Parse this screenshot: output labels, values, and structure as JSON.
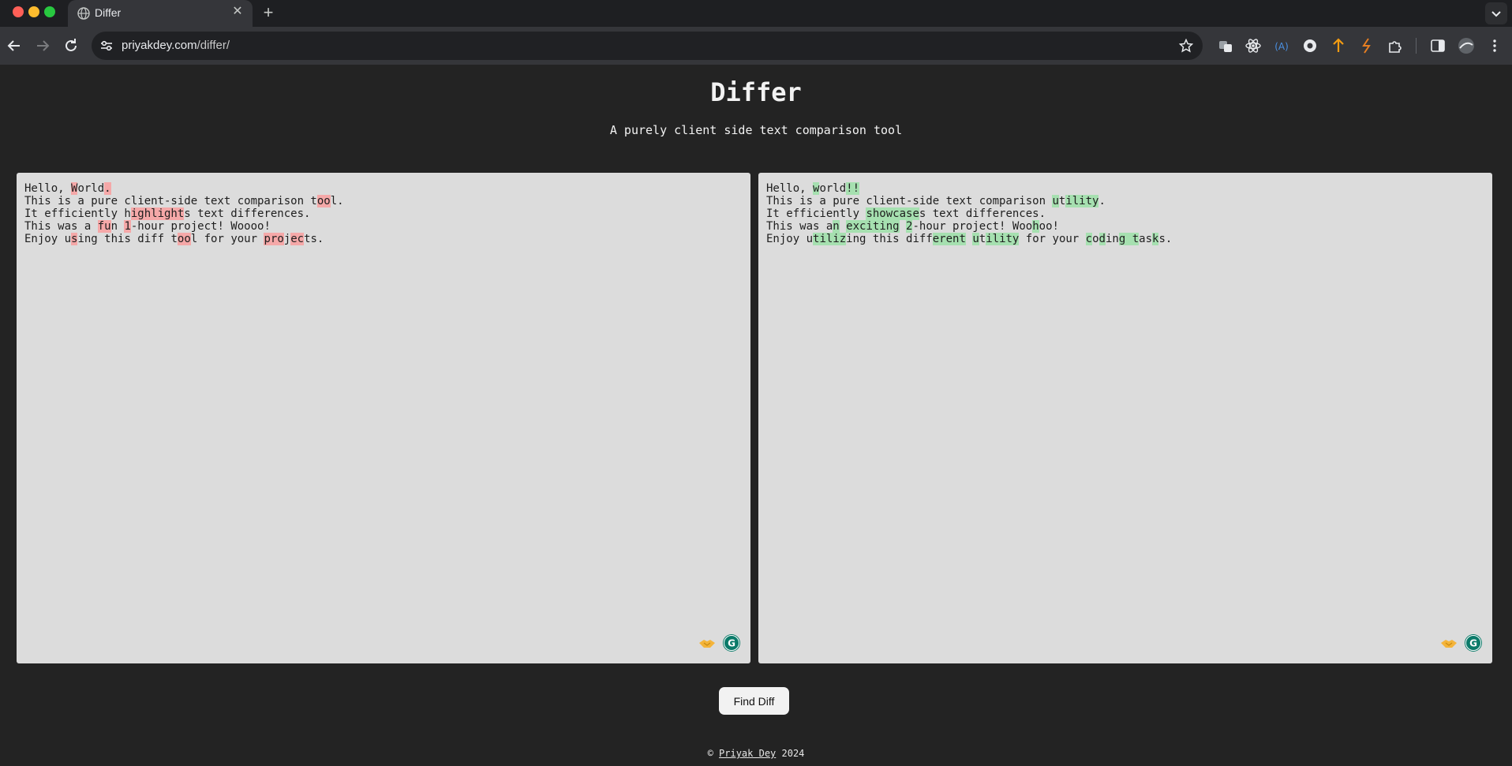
{
  "browser": {
    "tab": {
      "title": "Differ",
      "close": "✕"
    },
    "new_tab": "+",
    "omnibox": {
      "url_host": "priyakdey.com",
      "url_path": "/differ/"
    }
  },
  "page": {
    "title": "Differ",
    "subtitle": "A purely client side text comparison tool"
  },
  "left_pane": {
    "lines": [
      [
        {
          "t": "Hello, "
        },
        {
          "t": "W",
          "d": 1
        },
        {
          "t": "orld"
        },
        {
          "t": ".",
          "d": 1
        }
      ],
      [
        {
          "t": "This is a pure client-side text comparison t"
        },
        {
          "t": "oo",
          "d": 1
        },
        {
          "t": "l."
        }
      ],
      [
        {
          "t": "It efficiently h"
        },
        {
          "t": "ighlight",
          "d": 1
        },
        {
          "t": "s text differences."
        }
      ],
      [
        {
          "t": "This was a "
        },
        {
          "t": "fu",
          "d": 1
        },
        {
          "t": "n "
        },
        {
          "t": "1",
          "d": 1
        },
        {
          "t": "-hour project! Woooo!"
        }
      ],
      [
        {
          "t": "Enjoy u"
        },
        {
          "t": "s",
          "d": 1
        },
        {
          "t": "ing this diff t"
        },
        {
          "t": "oo",
          "d": 1
        },
        {
          "t": "l for your "
        },
        {
          "t": "pro",
          "d": 1
        },
        {
          "t": "j"
        },
        {
          "t": "ec",
          "d": 1
        },
        {
          "t": "ts."
        }
      ]
    ]
  },
  "right_pane": {
    "lines": [
      [
        {
          "t": "Hello, "
        },
        {
          "t": "w",
          "i": 1
        },
        {
          "t": "orld"
        },
        {
          "t": "!!",
          "i": 1
        }
      ],
      [
        {
          "t": "This is a pure client-side text comparison "
        },
        {
          "t": "u",
          "i": 1
        },
        {
          "t": "t"
        },
        {
          "t": "ility",
          "i": 1
        },
        {
          "t": "."
        }
      ],
      [
        {
          "t": "It efficiently "
        },
        {
          "t": "showcase",
          "i": 1
        },
        {
          "t": "s text differences."
        }
      ],
      [
        {
          "t": "This was a"
        },
        {
          "t": "n",
          "i": 1
        },
        {
          "t": " "
        },
        {
          "t": "exciting",
          "i": 1
        },
        {
          "t": " "
        },
        {
          "t": "2",
          "i": 1
        },
        {
          "t": "-hour project! Woo"
        },
        {
          "t": "h",
          "i": 1
        },
        {
          "t": "oo!"
        }
      ],
      [
        {
          "t": "Enjoy u"
        },
        {
          "t": "tiliz",
          "i": 1
        },
        {
          "t": "ing this diff"
        },
        {
          "t": "erent",
          "i": 1
        },
        {
          "t": " "
        },
        {
          "t": "u",
          "i": 1
        },
        {
          "t": "t"
        },
        {
          "t": "ility",
          "i": 1
        },
        {
          "t": " for your "
        },
        {
          "t": "c",
          "i": 1
        },
        {
          "t": "o"
        },
        {
          "t": "d",
          "i": 1
        },
        {
          "t": "in"
        },
        {
          "t": "g t",
          "i": 1
        },
        {
          "t": "as"
        },
        {
          "t": "k",
          "i": 1
        },
        {
          "t": "s."
        }
      ]
    ]
  },
  "find_button": {
    "label": "Find Diff"
  },
  "footer": {
    "prefix": "© ",
    "author": "Priyak Dey",
    "year": " 2024"
  },
  "colors": {
    "background": "#232323",
    "pane": "#dcdcdc",
    "deletion": "#f5a8a8",
    "insertion": "#a6e0b0"
  },
  "icons": {
    "nav": [
      "back-arrow-icon",
      "forward-arrow-icon",
      "reload-icon"
    ],
    "omnibox": [
      "site-settings-icon",
      "bookmark-star-icon"
    ],
    "extensions": [
      "translate-icon",
      "react-devtools-icon",
      "font-extension-icon",
      "dark-circle-icon",
      "upload-arrow-icon",
      "lightning-icon",
      "extensions-puzzle-icon",
      "side-panel-icon",
      "profile-avatar-icon",
      "kebab-menu-icon"
    ],
    "pane": [
      "handshake-icon",
      "grammarly-icon"
    ]
  }
}
